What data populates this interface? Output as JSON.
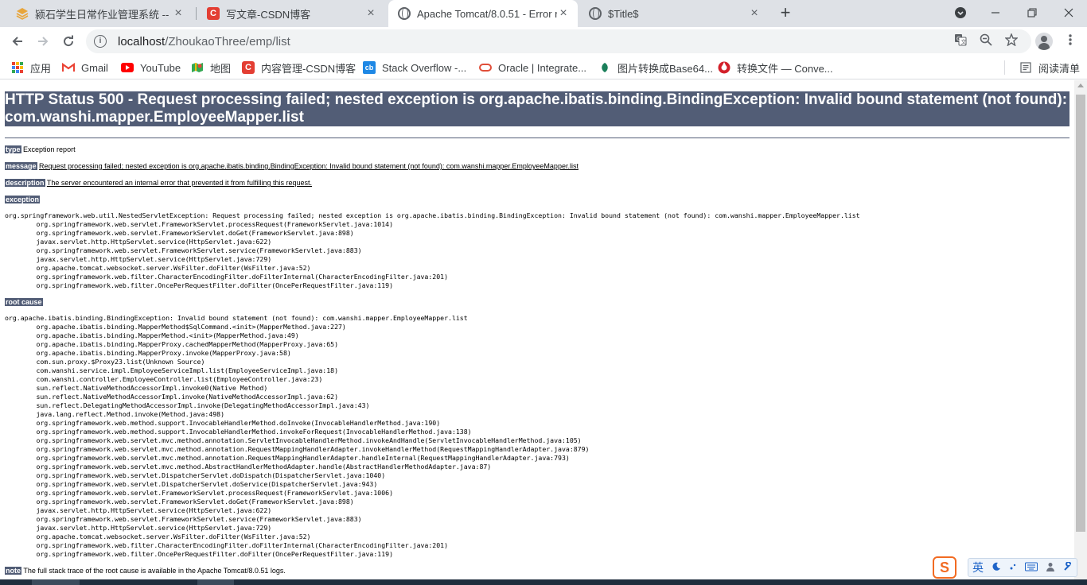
{
  "tabs": [
    {
      "title": "颍石学生日常作业管理系统 -- 全...",
      "icon": "stack-icon"
    },
    {
      "title": "写文章-CSDN博客",
      "icon": "csdn-icon"
    },
    {
      "title": "Apache Tomcat/8.0.51 - Error r...",
      "icon": "globe-icon",
      "active": true
    },
    {
      "title": "$Title$",
      "icon": "globe-icon"
    }
  ],
  "toolbar": {
    "url_host": "localhost",
    "url_path": "/ZhoukaoThree/emp/list"
  },
  "bookmarks": [
    {
      "label": "应用",
      "icon": "apps-grid-icon"
    },
    {
      "label": "Gmail",
      "icon": "gmail-icon"
    },
    {
      "label": "YouTube",
      "icon": "youtube-icon"
    },
    {
      "label": "地图",
      "icon": "maps-icon"
    },
    {
      "label": "内容管理-CSDN博客",
      "icon": "csdn-icon"
    },
    {
      "label": "Stack Overflow -...",
      "icon": "stackoverflow-icon"
    },
    {
      "label": "Oracle | Integrate...",
      "icon": "oracle-icon"
    },
    {
      "label": "图片转换成Base64...",
      "icon": "leaf-icon"
    },
    {
      "label": "转换文件 — Conve...",
      "icon": "convert-icon"
    },
    {
      "label": "阅读清单",
      "icon": "reading-list-icon"
    }
  ],
  "error": {
    "title": "HTTP Status 500 - Request processing failed; nested exception is org.apache.ibatis.binding.BindingException: Invalid bound statement (not found): com.wanshi.mapper.EmployeeMapper.list",
    "type_label": "type",
    "type_value": "Exception report",
    "message_label": "message",
    "message_value": "Request processing failed; nested exception is org.apache.ibatis.binding.BindingException: Invalid bound statement (not found): com.wanshi.mapper.EmployeeMapper.list",
    "description_label": "description",
    "description_value": "The server encountered an internal error that prevented it from fulfilling this request.",
    "exception_label": "exception",
    "exception_trace": "org.springframework.web.util.NestedServletException: Request processing failed; nested exception is org.apache.ibatis.binding.BindingException: Invalid bound statement (not found): com.wanshi.mapper.EmployeeMapper.list\n\torg.springframework.web.servlet.FrameworkServlet.processRequest(FrameworkServlet.java:1014)\n\torg.springframework.web.servlet.FrameworkServlet.doGet(FrameworkServlet.java:898)\n\tjavax.servlet.http.HttpServlet.service(HttpServlet.java:622)\n\torg.springframework.web.servlet.FrameworkServlet.service(FrameworkServlet.java:883)\n\tjavax.servlet.http.HttpServlet.service(HttpServlet.java:729)\n\torg.apache.tomcat.websocket.server.WsFilter.doFilter(WsFilter.java:52)\n\torg.springframework.web.filter.CharacterEncodingFilter.doFilterInternal(CharacterEncodingFilter.java:201)\n\torg.springframework.web.filter.OncePerRequestFilter.doFilter(OncePerRequestFilter.java:119)",
    "root_cause_label": "root cause",
    "root_cause_trace": "org.apache.ibatis.binding.BindingException: Invalid bound statement (not found): com.wanshi.mapper.EmployeeMapper.list\n\torg.apache.ibatis.binding.MapperMethod$SqlCommand.<init>(MapperMethod.java:227)\n\torg.apache.ibatis.binding.MapperMethod.<init>(MapperMethod.java:49)\n\torg.apache.ibatis.binding.MapperProxy.cachedMapperMethod(MapperProxy.java:65)\n\torg.apache.ibatis.binding.MapperProxy.invoke(MapperProxy.java:58)\n\tcom.sun.proxy.$Proxy23.list(Unknown Source)\n\tcom.wanshi.service.impl.EmployeeServiceImpl.list(EmployeeServiceImpl.java:18)\n\tcom.wanshi.controller.EmployeeController.list(EmployeeController.java:23)\n\tsun.reflect.NativeMethodAccessorImpl.invoke0(Native Method)\n\tsun.reflect.NativeMethodAccessorImpl.invoke(NativeMethodAccessorImpl.java:62)\n\tsun.reflect.DelegatingMethodAccessorImpl.invoke(DelegatingMethodAccessorImpl.java:43)\n\tjava.lang.reflect.Method.invoke(Method.java:498)\n\torg.springframework.web.method.support.InvocableHandlerMethod.doInvoke(InvocableHandlerMethod.java:190)\n\torg.springframework.web.method.support.InvocableHandlerMethod.invokeForRequest(InvocableHandlerMethod.java:138)\n\torg.springframework.web.servlet.mvc.method.annotation.ServletInvocableHandlerMethod.invokeAndHandle(ServletInvocableHandlerMethod.java:105)\n\torg.springframework.web.servlet.mvc.method.annotation.RequestMappingHandlerAdapter.invokeHandlerMethod(RequestMappingHandlerAdapter.java:879)\n\torg.springframework.web.servlet.mvc.method.annotation.RequestMappingHandlerAdapter.handleInternal(RequestMappingHandlerAdapter.java:793)\n\torg.springframework.web.servlet.mvc.method.AbstractHandlerMethodAdapter.handle(AbstractHandlerMethodAdapter.java:87)\n\torg.springframework.web.servlet.DispatcherServlet.doDispatch(DispatcherServlet.java:1040)\n\torg.springframework.web.servlet.DispatcherServlet.doService(DispatcherServlet.java:943)\n\torg.springframework.web.servlet.FrameworkServlet.processRequest(FrameworkServlet.java:1006)\n\torg.springframework.web.servlet.FrameworkServlet.doGet(FrameworkServlet.java:898)\n\tjavax.servlet.http.HttpServlet.service(HttpServlet.java:622)\n\torg.springframework.web.servlet.FrameworkServlet.service(FrameworkServlet.java:883)\n\tjavax.servlet.http.HttpServlet.service(HttpServlet.java:729)\n\torg.apache.tomcat.websocket.server.WsFilter.doFilter(WsFilter.java:52)\n\torg.springframework.web.filter.CharacterEncodingFilter.doFilterInternal(CharacterEncodingFilter.java:201)\n\torg.springframework.web.filter.OncePerRequestFilter.doFilter(OncePerRequestFilter.java:119)",
    "note_label": "note",
    "note_value": "The full stack trace of the root cause is available in the Apache Tomcat/8.0.51 logs."
  },
  "ime": {
    "logo": "S",
    "lang": "英",
    "icons": [
      "moon-icon",
      "punctuation-icon",
      "keyboard-icon",
      "user-icon",
      "wrench-icon"
    ]
  },
  "colors": {
    "tomcat_header_bg": "#525d76",
    "tabstrip_bg": "#dee1e6",
    "csdn_red": "#e33e33"
  }
}
